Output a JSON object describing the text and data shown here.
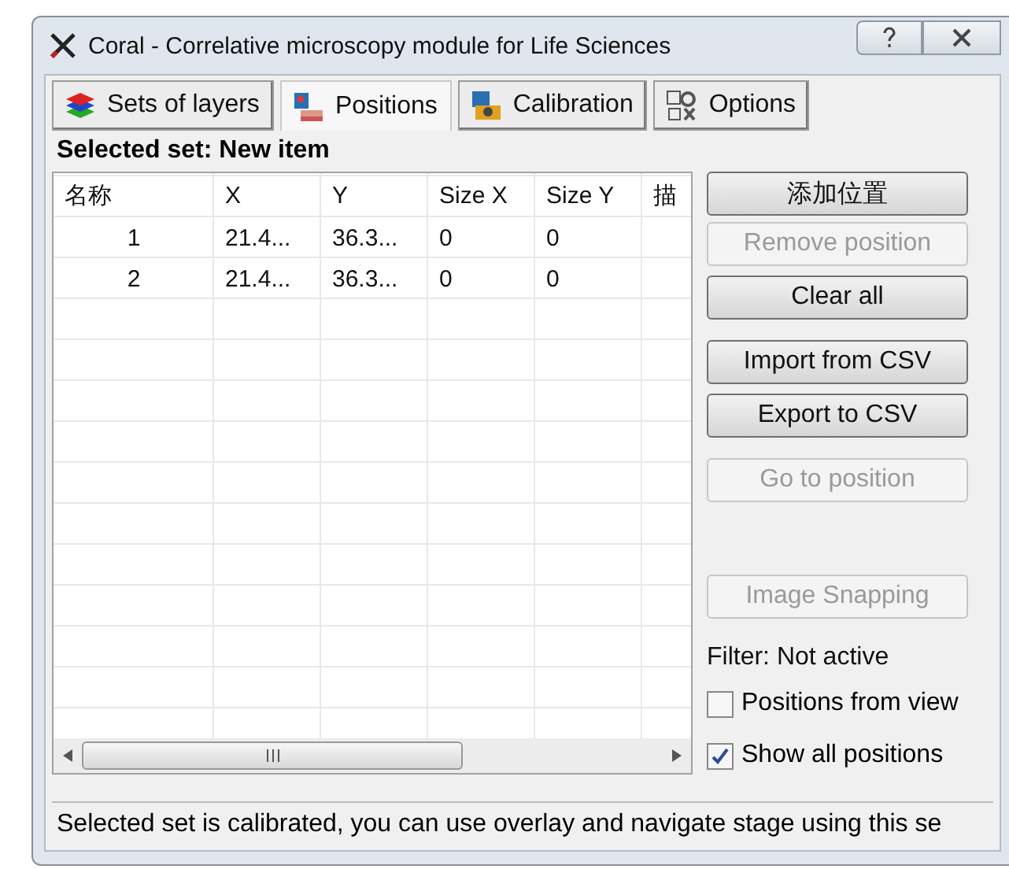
{
  "window": {
    "title": "Coral - Correlative microscopy module for Life Sciences"
  },
  "tabs": [
    {
      "label": "Sets of layers",
      "selected": false,
      "kind": "layers"
    },
    {
      "label": "Positions",
      "selected": true,
      "kind": "positions"
    },
    {
      "label": "Calibration",
      "selected": false,
      "kind": "calibration"
    },
    {
      "label": "Options",
      "selected": false,
      "kind": "options"
    }
  ],
  "selected_set": "Selected set: New item",
  "table": {
    "columns": [
      "名称",
      "X",
      "Y",
      "Size X",
      "Size Y",
      "描"
    ],
    "rows": [
      [
        "1",
        "21.4...",
        "36.3...",
        "0",
        "0"
      ],
      [
        "2",
        "21.4...",
        "36.3...",
        "0",
        "0"
      ]
    ]
  },
  "buttons": [
    {
      "label": "添加位置",
      "disabled": false
    },
    {
      "label": "Remove position",
      "disabled": true
    },
    {
      "label": "Clear all",
      "disabled": false
    },
    {
      "label": "Import from CSV",
      "disabled": false
    },
    {
      "label": "Export to CSV",
      "disabled": false
    },
    {
      "label": "Go to position",
      "disabled": true
    },
    {
      "label": "Image Snapping",
      "disabled": true
    }
  ],
  "filter": "Filter: Not active",
  "checkboxes": [
    {
      "label": "Positions from view",
      "checked": false
    },
    {
      "label": "Show all positions",
      "checked": true
    }
  ],
  "status_bar": "Selected set is calibrated, you can use overlay and navigate stage using this se"
}
